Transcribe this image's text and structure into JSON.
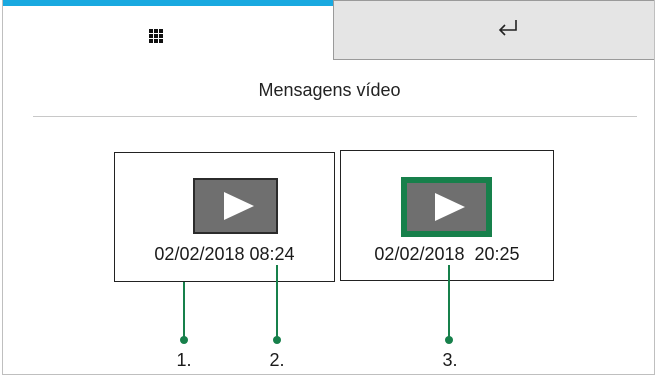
{
  "tabs": [
    {
      "icon": "grid-icon",
      "active": true
    },
    {
      "icon": "back-arrow-icon",
      "active": false
    }
  ],
  "colors": {
    "accent": "#19a9e0",
    "selection": "#17804b",
    "thumbnail": "#6f6f6f"
  },
  "page": {
    "title": "Mensagens vídeo"
  },
  "messages": [
    {
      "date": "02/02/2018 08:24",
      "selected": false
    },
    {
      "date": "02/02/2018  20:25",
      "selected": true
    }
  ],
  "callouts": [
    "1.",
    "2.",
    "3."
  ]
}
